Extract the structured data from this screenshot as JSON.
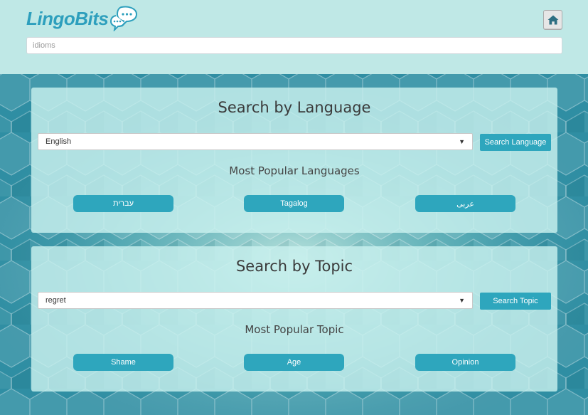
{
  "header": {
    "logo_text": "LingoBits",
    "search": {
      "value": "idioms",
      "placeholder": ""
    }
  },
  "language_section": {
    "title": "Search by Language",
    "selected": "English",
    "button_label": "Search Language",
    "popular_heading": "Most Popular Languages",
    "popular": [
      "עברית",
      "Tagalog",
      "عربى"
    ]
  },
  "topic_section": {
    "title": "Search by Topic",
    "selected": "regret",
    "button_label": "Search Topic",
    "popular_heading": "Most Popular Topic",
    "popular": [
      "Shame",
      "Age",
      "Opinion"
    ]
  },
  "colors": {
    "accent": "#2ea6bd",
    "header_bg": "#bfe8e6",
    "card_bg": "#c8f0ee"
  },
  "icons": {
    "logo": "speech-bubbles-icon",
    "home": "home-icon",
    "dropdown": "caret-down-icon"
  }
}
